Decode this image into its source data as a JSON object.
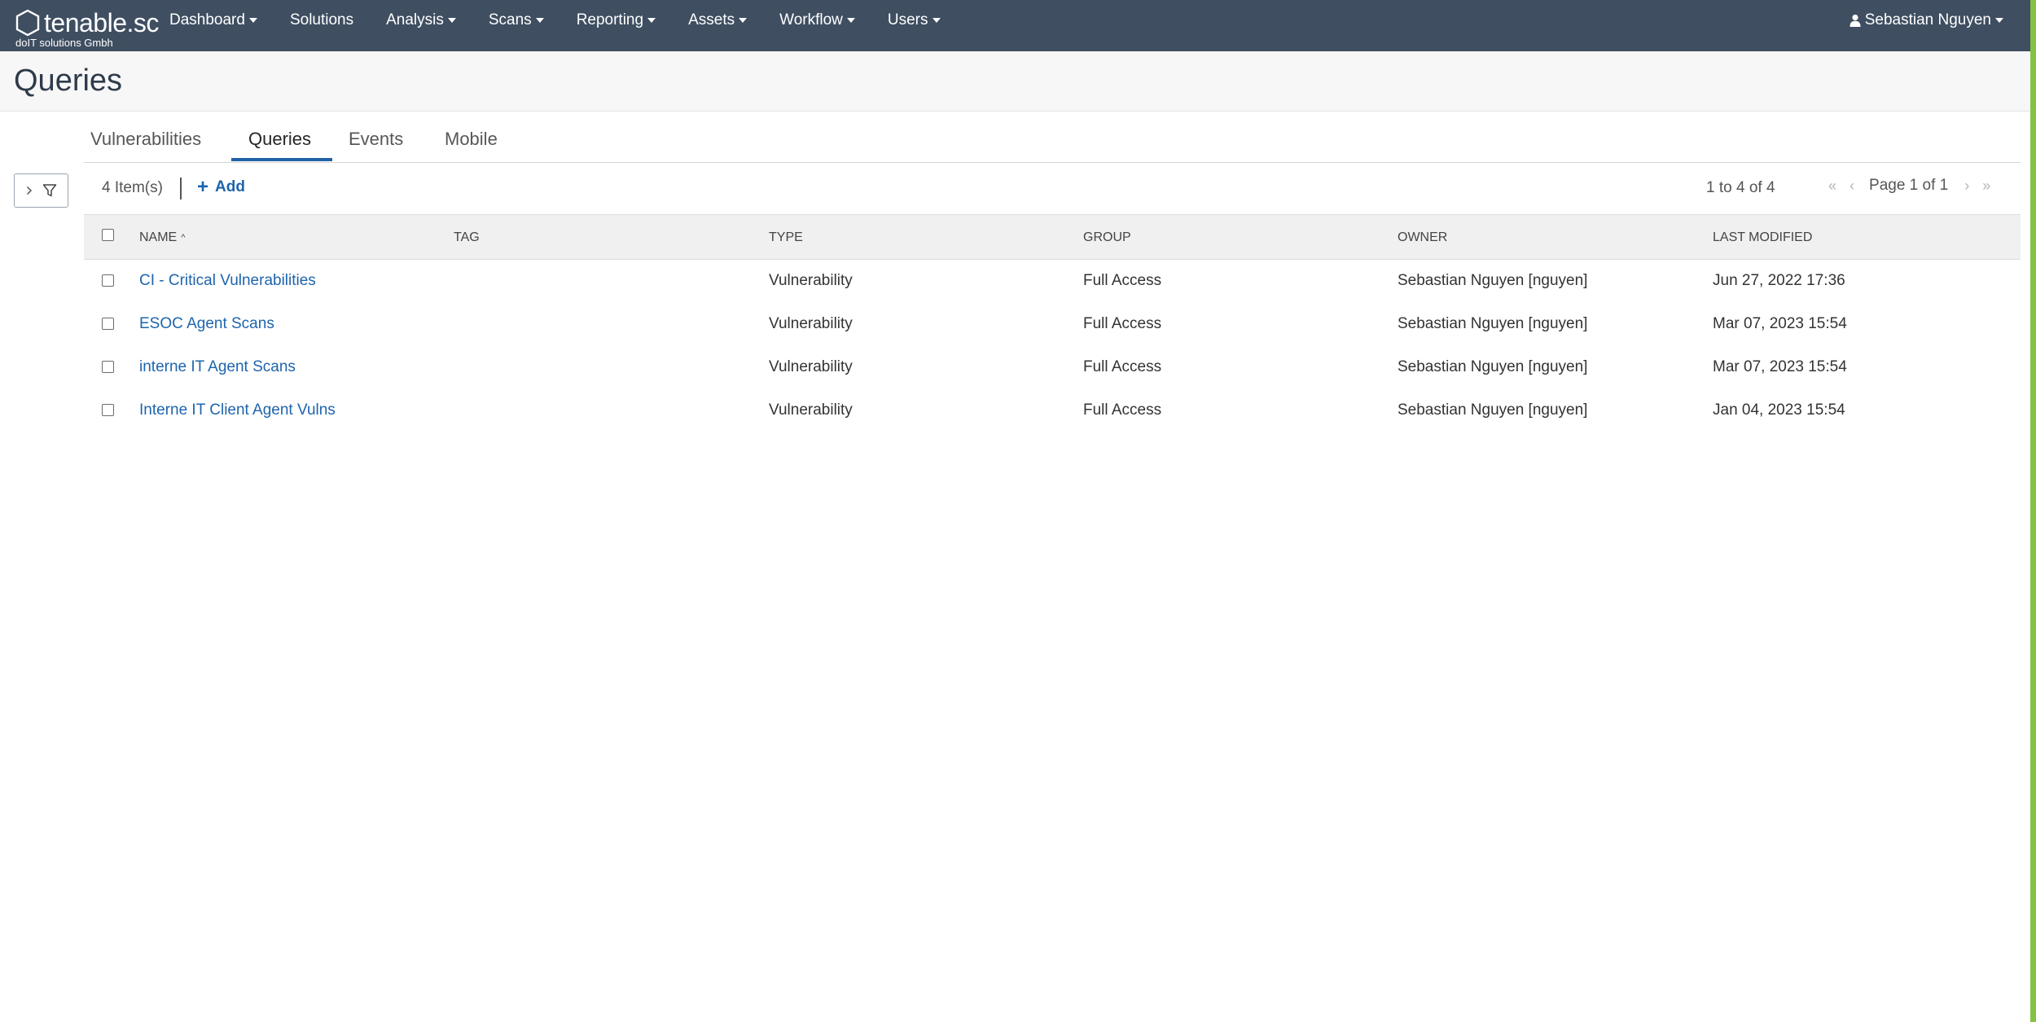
{
  "app": {
    "logo_text": "tenable.sc",
    "org_name": "doIT solutions Gmbh"
  },
  "nav": {
    "items": [
      {
        "label": "Dashboard",
        "has_caret": true
      },
      {
        "label": "Solutions",
        "has_caret": false
      },
      {
        "label": "Analysis",
        "has_caret": true
      },
      {
        "label": "Scans",
        "has_caret": true
      },
      {
        "label": "Reporting",
        "has_caret": true
      },
      {
        "label": "Assets",
        "has_caret": true
      },
      {
        "label": "Workflow",
        "has_caret": true
      },
      {
        "label": "Users",
        "has_caret": true
      }
    ],
    "user": "Sebastian Nguyen"
  },
  "page": {
    "title": "Queries"
  },
  "tabs": [
    {
      "label": "Vulnerabilities",
      "active": false
    },
    {
      "label": "Queries",
      "active": true
    },
    {
      "label": "Events",
      "active": false
    },
    {
      "label": "Mobile",
      "active": false
    }
  ],
  "toolbar": {
    "items_count": "4 Item(s)",
    "add_label": "Add",
    "range": "1 to 4 of 4",
    "page_label": "Page 1 of 1"
  },
  "table": {
    "columns": [
      "Name",
      "Tag",
      "Type",
      "Group",
      "Owner",
      "Last Modified"
    ],
    "sorted_column": "Name",
    "rows": [
      {
        "name": "CI - Critical Vulnerabilities",
        "tag": "",
        "type": "Vulnerability",
        "group": "Full Access",
        "owner": "Sebastian Nguyen [nguyen]",
        "modified": "Jun 27, 2022 17:36"
      },
      {
        "name": "ESOC Agent Scans",
        "tag": "",
        "type": "Vulnerability",
        "group": "Full Access",
        "owner": "Sebastian Nguyen [nguyen]",
        "modified": "Mar 07, 2023 15:54"
      },
      {
        "name": "interne IT Agent Scans",
        "tag": "",
        "type": "Vulnerability",
        "group": "Full Access",
        "owner": "Sebastian Nguyen [nguyen]",
        "modified": "Mar 07, 2023 15:54"
      },
      {
        "name": "Interne IT Client Agent Vulns",
        "tag": "",
        "type": "Vulnerability",
        "group": "Full Access",
        "owner": "Sebastian Nguyen [nguyen]",
        "modified": "Jan 04, 2023 15:54"
      }
    ]
  },
  "colors": {
    "nav_bg": "#3f4e61",
    "link": "#1e64ad",
    "accent_edge": "#84c341",
    "tab_active_underline": "#2162a6"
  }
}
